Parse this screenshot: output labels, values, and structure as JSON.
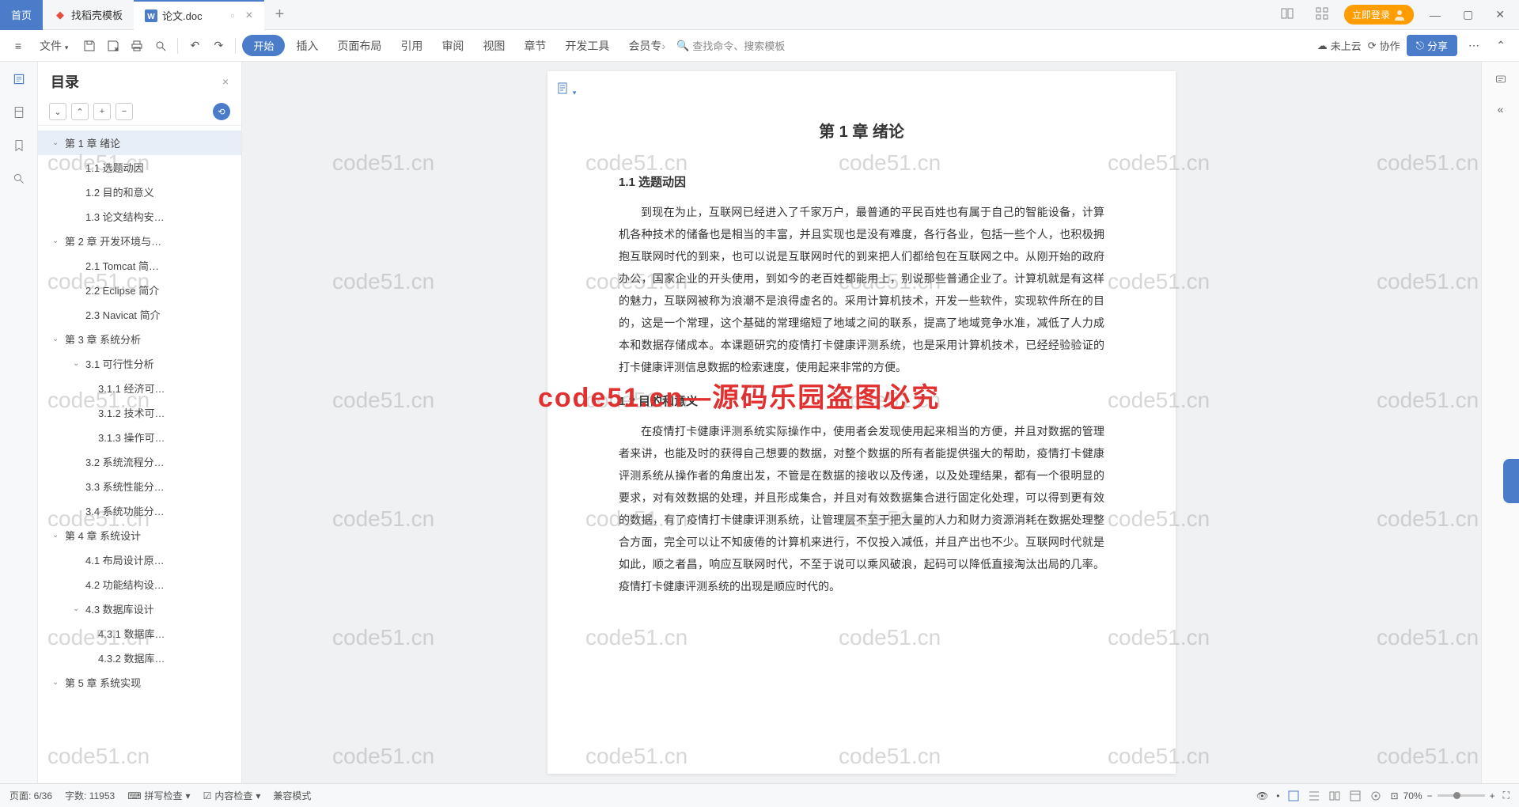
{
  "titlebar": {
    "home": "首页",
    "tab_template": "找稻壳模板",
    "tab_doc": "论文.doc",
    "login": "立即登录"
  },
  "toolbar": {
    "file": "文件",
    "start": "开始",
    "insert": "插入",
    "layout": "页面布局",
    "ref": "引用",
    "review": "审阅",
    "view": "视图",
    "section": "章节",
    "dev": "开发工具",
    "member": "会员专",
    "search": "查找命令、搜索模板",
    "nocloud": "未上云",
    "collab": "协作",
    "share": "分享"
  },
  "outline": {
    "title": "目录",
    "items": [
      {
        "lvl": 1,
        "chev": "⌄",
        "text": "第 1 章 绪论",
        "sel": true
      },
      {
        "lvl": 2,
        "text": "1.1 选题动因"
      },
      {
        "lvl": 2,
        "text": "1.2 目的和意义"
      },
      {
        "lvl": 2,
        "text": "1.3 论文结构安…"
      },
      {
        "lvl": 1,
        "chev": "⌄",
        "text": "第 2 章 开发环境与…"
      },
      {
        "lvl": 2,
        "text": "2.1 Tomcat 简…"
      },
      {
        "lvl": 2,
        "text": "2.2 Eclipse 简介"
      },
      {
        "lvl": 2,
        "text": "2.3 Navicat 简介"
      },
      {
        "lvl": 1,
        "chev": "⌄",
        "text": "第 3 章 系统分析"
      },
      {
        "lvl": 2,
        "chev": "⌄",
        "text": "3.1 可行性分析"
      },
      {
        "lvl": 3,
        "text": "3.1.1 经济可…"
      },
      {
        "lvl": 3,
        "text": "3.1.2 技术可…"
      },
      {
        "lvl": 3,
        "text": "3.1.3 操作可…"
      },
      {
        "lvl": 2,
        "text": "3.2 系统流程分…"
      },
      {
        "lvl": 2,
        "text": "3.3 系统性能分…"
      },
      {
        "lvl": 2,
        "text": "3.4 系统功能分…"
      },
      {
        "lvl": 1,
        "chev": "⌄",
        "text": "第 4 章 系统设计"
      },
      {
        "lvl": 2,
        "text": "4.1 布局设计原…"
      },
      {
        "lvl": 2,
        "text": "4.2 功能结构设…"
      },
      {
        "lvl": 2,
        "chev": "⌄",
        "text": "4.3 数据库设计"
      },
      {
        "lvl": 3,
        "text": "4.3.1 数据库…"
      },
      {
        "lvl": 3,
        "text": "4.3.2 数据库…"
      },
      {
        "lvl": 1,
        "chev": "⌄",
        "text": "第 5 章 系统实现"
      }
    ]
  },
  "doc": {
    "chapter": "第 1 章 绪论",
    "s1": "1.1 选题动因",
    "p1": "到现在为止，互联网已经进入了千家万户，最普通的平民百姓也有属于自己的智能设备，计算机各种技术的储备也是相当的丰富，并且实现也是没有难度，各行各业，包括一些个人，也积极拥抱互联网时代的到来，也可以说是互联网时代的到来把人们都给包在互联网之中。从刚开始的政府办公，国家企业的开头使用，到如今的老百姓都能用上，别说那些普通企业了。计算机就是有这样的魅力，互联网被称为浪潮不是浪得虚名的。采用计算机技术，开发一些软件，实现软件所在的目的，这是一个常理，这个基础的常理缩短了地域之间的联系，提高了地域竞争水准，减低了人力成本和数据存储成本。本课题研究的疫情打卡健康评测系统，也是采用计算机技术，已经经验验证的打卡健康评测信息数据的检索速度，使用起来非常的方便。",
    "s2": "1.2 目的和意义",
    "p2": "在疫情打卡健康评测系统实际操作中，使用者会发现使用起来相当的方便，并且对数据的管理者来讲，也能及时的获得自己想要的数据，对整个数据的所有者能提供强大的帮助，疫情打卡健康评测系统从操作者的角度出发，不管是在数据的接收以及传递，以及处理结果，都有一个很明显的要求，对有效数据的处理，并且形成集合，并且对有效数据集合进行固定化处理，可以得到更有效的数据，有了疫情打卡健康评测系统，让管理层不至于把大量的人力和财力资源消耗在数据处理整合方面，完全可以让不知疲倦的计算机来进行，不仅投入减低，并且产出也不少。互联网时代就是如此，顺之者昌，响应互联网时代，不至于说可以乘风破浪，起码可以降低直接淘汰出局的几率。疫情打卡健康评测系统的出现是顺应时代的。"
  },
  "status": {
    "page": "页面: 6/36",
    "words": "字数: 11953",
    "spell": "拼写检查 ",
    "content": "内容检查 ",
    "compat": "兼容模式",
    "zoom": "70%"
  },
  "wm_text": "code51.cn",
  "wm_red": "code51.cn—源码乐园盗图必究"
}
